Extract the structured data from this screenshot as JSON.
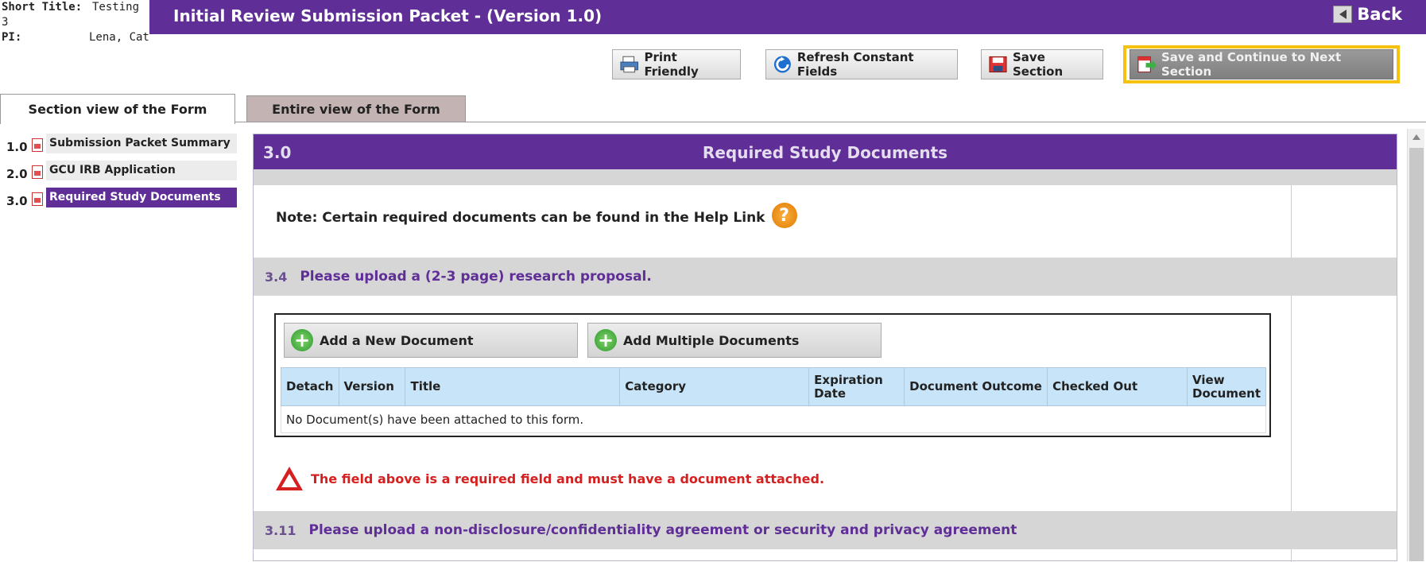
{
  "header": {
    "short_title_label": "Short Title:",
    "short_title_value": "Testing 3",
    "pi_label": "PI:",
    "pi_value": "Lena, Cat",
    "title": "Initial Review Submission Packet - (Version 1.0)",
    "back_label": "Back"
  },
  "toolbar": {
    "print_label": "Print Friendly",
    "refresh_label": "Refresh Constant Fields",
    "save_label": "Save Section",
    "save_continue_label": "Save and Continue to Next Section",
    "highlight_color": "#f5c211"
  },
  "tabs": {
    "section_view": "Section view of the Form",
    "entire_view": "Entire view of the Form"
  },
  "nav": {
    "items": [
      {
        "num": "1.0",
        "label": "Submission Packet Summary"
      },
      {
        "num": "2.0",
        "label": "GCU IRB Application"
      },
      {
        "num": "3.0",
        "label": "Required Study Documents"
      }
    ]
  },
  "section": {
    "number": "3.0",
    "title": "Required Study Documents",
    "note": "Note: Certain required documents can be found in the Help Link",
    "help_icon": "?",
    "q1_num": "3.4",
    "q1_text": "Please upload a (2-3 page) research proposal.",
    "add_new_label": "Add a New Document",
    "add_multiple_label": "Add Multiple Documents",
    "columns": [
      "Detach",
      "Version",
      "Title",
      "Category",
      "Expiration Date",
      "Document Outcome",
      "Checked Out",
      "View Document"
    ],
    "empty_message": "No Document(s) have been attached to this form.",
    "warning": "The field above is a required field and must have a document attached.",
    "q2_num": "3.11",
    "q2_text": "Please upload a non-disclosure/confidentiality agreement or security and privacy agreement"
  },
  "colors": {
    "brand_purple": "#5f2e96",
    "warning_red": "#d62020",
    "table_header": "#c8e4f8"
  }
}
